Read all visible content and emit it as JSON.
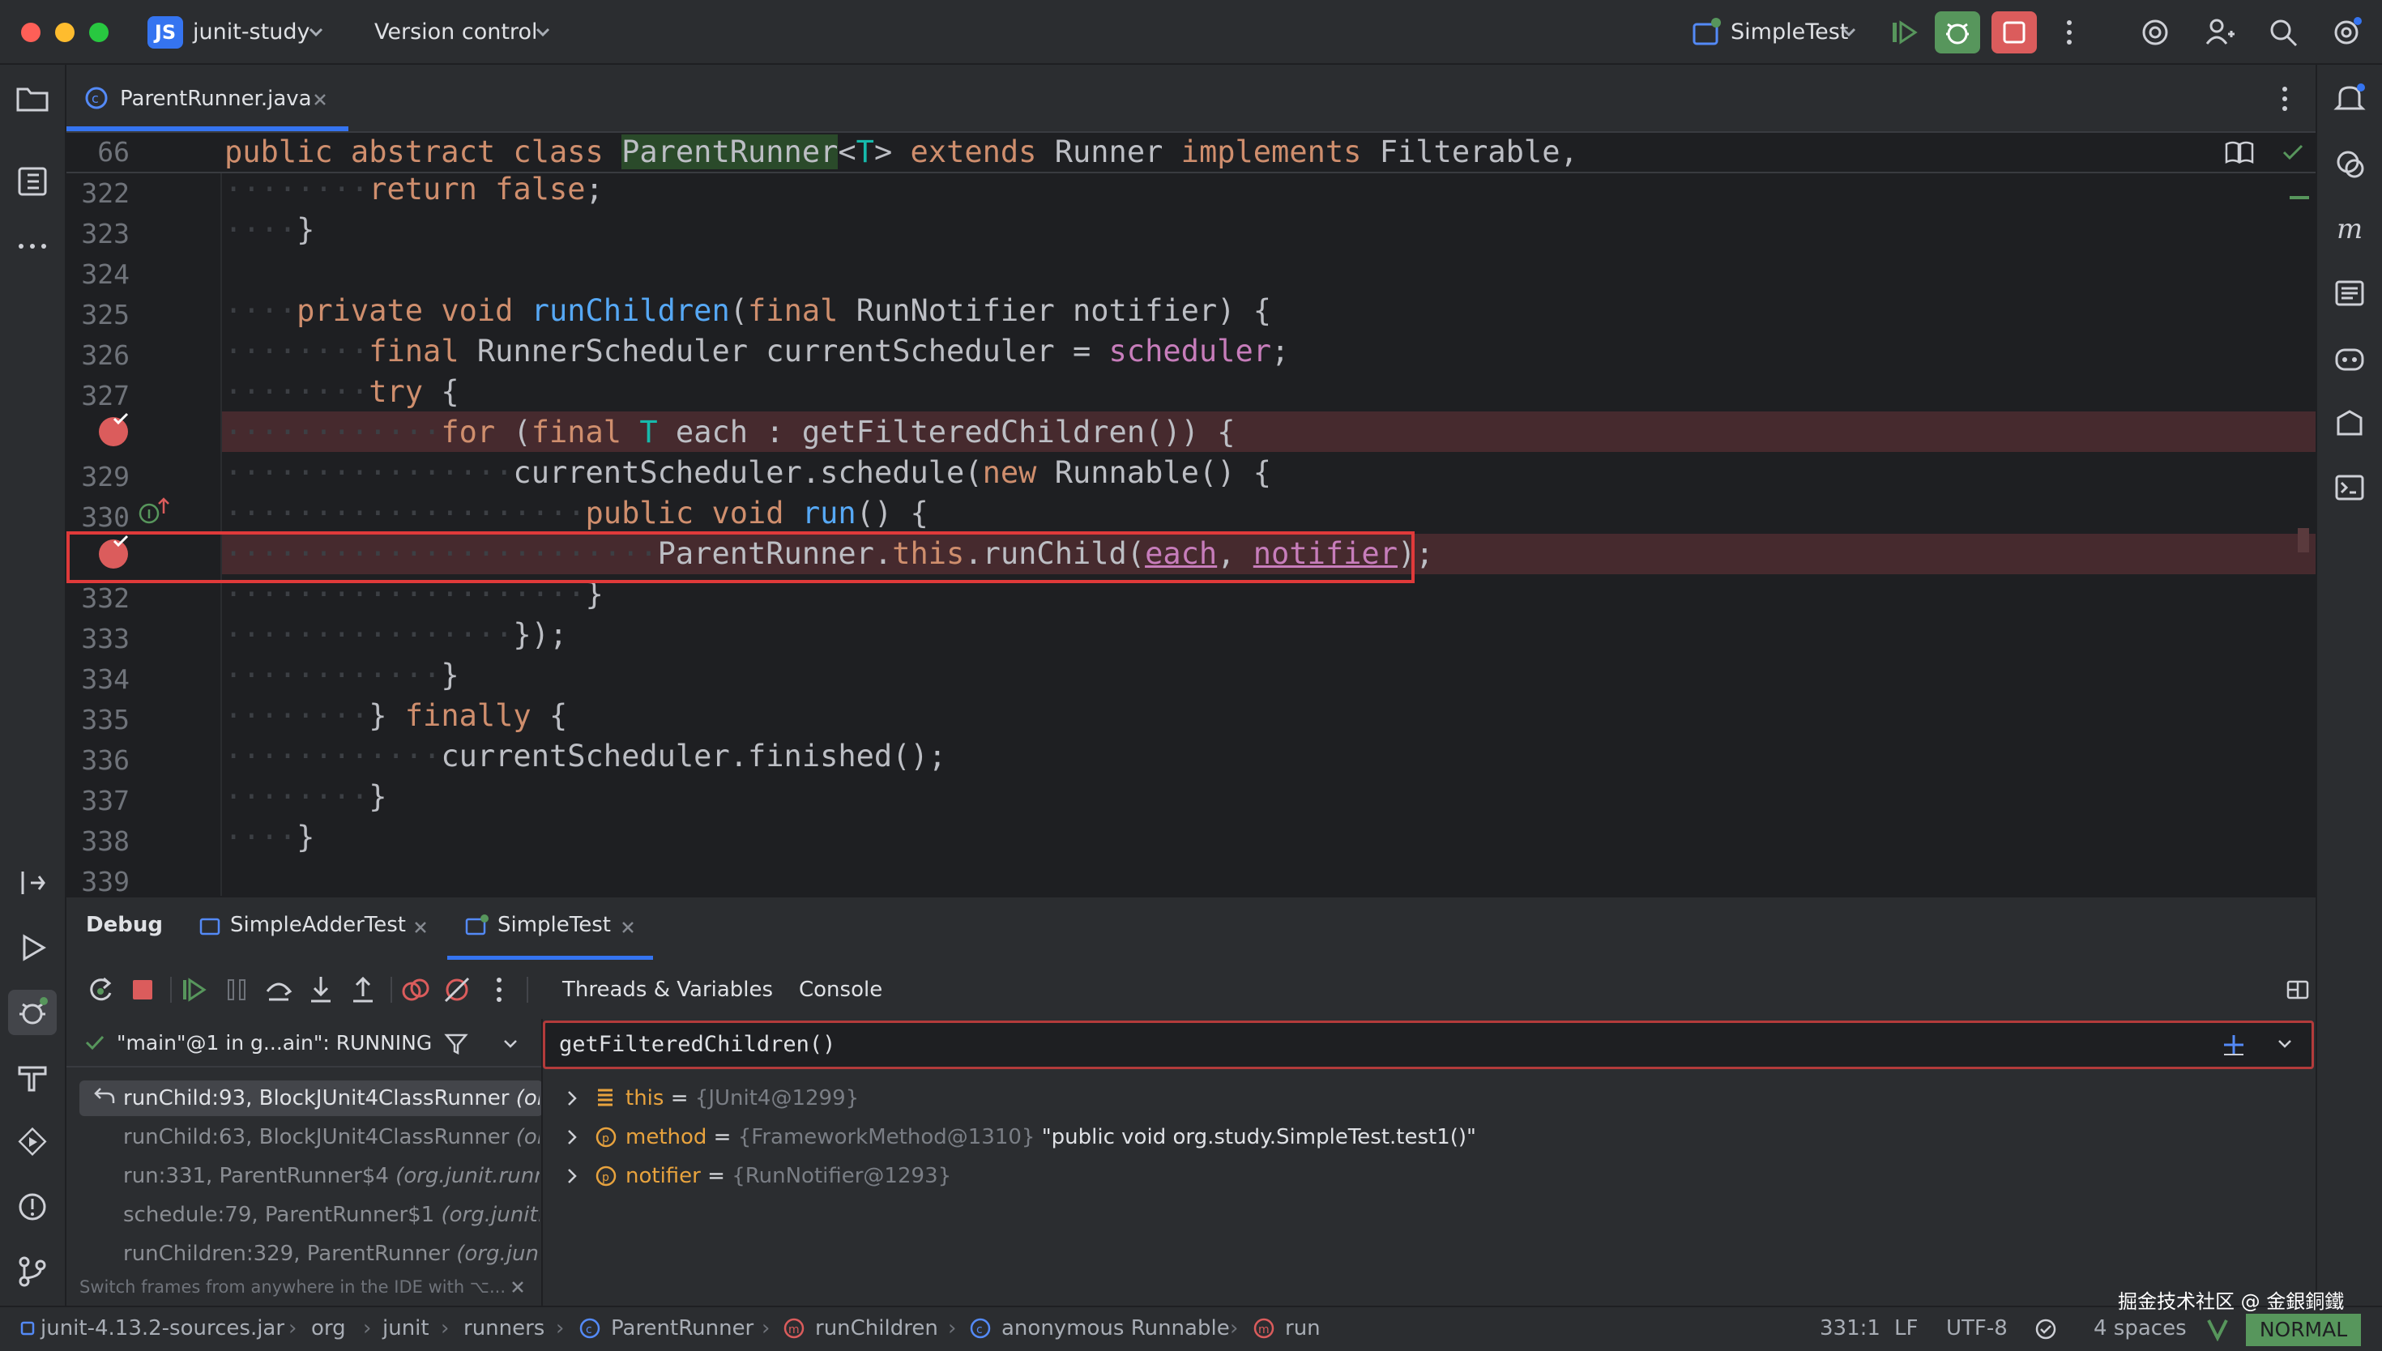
{
  "titlebar": {
    "project_badge": "JS",
    "project_name": "junit-study",
    "vcs_label": "Version control",
    "run_config": "SimpleTest"
  },
  "editor": {
    "tab_label": "ParentRunner.java",
    "sticky_line_number": "66",
    "lines": [
      {
        "n": "322"
      },
      {
        "n": "323"
      },
      {
        "n": "324"
      },
      {
        "n": "325"
      },
      {
        "n": "326"
      },
      {
        "n": "327"
      },
      {
        "n": ""
      },
      {
        "n": "329"
      },
      {
        "n": "330"
      },
      {
        "n": ""
      },
      {
        "n": "332"
      },
      {
        "n": "333"
      },
      {
        "n": "334"
      },
      {
        "n": "335"
      },
      {
        "n": "336"
      },
      {
        "n": "337"
      },
      {
        "n": "338"
      },
      {
        "n": "339"
      }
    ]
  },
  "debug": {
    "title": "Debug",
    "session_tabs": [
      {
        "label": "SimpleAdderTest"
      },
      {
        "label": "SimpleTest"
      }
    ],
    "view_tabs": [
      "Threads & Variables",
      "Console"
    ],
    "thread_selector": "\"main\"@1 in g...ain\": RUNNING",
    "frames": [
      {
        "name": "runChild:93, BlockJUnit4ClassRunner",
        "pkg": "(org"
      },
      {
        "name": "runChild:63, BlockJUnit4ClassRunner",
        "pkg": "(org"
      },
      {
        "name": "run:331, ParentRunner$4",
        "pkg": "(org.junit.runner"
      },
      {
        "name": "schedule:79, ParentRunner$1",
        "pkg": "(org.junit.ru"
      },
      {
        "name": "runChildren:329, ParentRunner",
        "pkg": "(org.junit.r"
      }
    ],
    "frames_hint": "Switch frames from anywhere in the IDE with ⌥...",
    "eval_expression": "getFilteredChildren()",
    "variables": [
      {
        "name": "this",
        "eq": " = ",
        "ref": "{JUnit4@1299}",
        "val": ""
      },
      {
        "name": "method",
        "eq": " = ",
        "ref": "{FrameworkMethod@1310}",
        "val": " \"public void org.study.SimpleTest.test1()\""
      },
      {
        "name": "notifier",
        "eq": " = ",
        "ref": "{RunNotifier@1293}",
        "val": ""
      }
    ]
  },
  "statusbar": {
    "crumbs": [
      "junit-4.13.2-sources.jar",
      "org",
      "junit",
      "runners",
      "ParentRunner",
      "runChildren",
      "anonymous Runnable",
      "run"
    ],
    "position": "331:1",
    "line_sep": "LF",
    "encoding": "UTF-8",
    "indent": "4 spaces",
    "vim_mode": "NORMAL",
    "watermark": "掘金技术社区 @ 金銀銅鐵"
  },
  "colors": {
    "accent": "#3574f0",
    "breakpoint": "#db5c5c",
    "run_green": "#57965c",
    "stop_red": "#db5c5c"
  }
}
